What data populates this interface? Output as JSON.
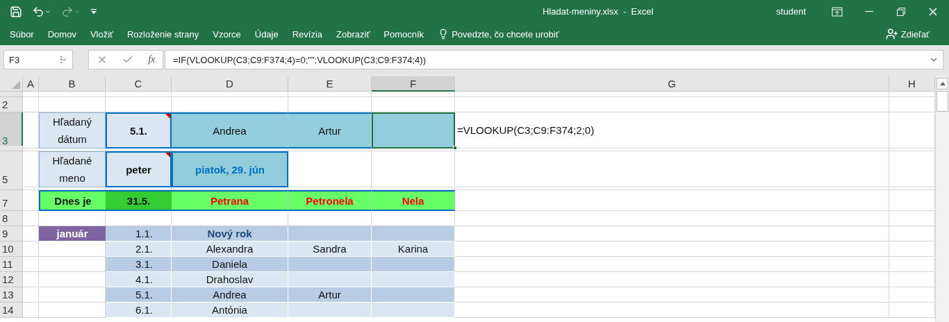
{
  "title_bar": {
    "quick_access": [
      {
        "kind": "save",
        "disabled": false
      },
      {
        "kind": "undo",
        "disabled": false
      },
      {
        "kind": "redo",
        "disabled": true
      },
      {
        "kind": "customize",
        "disabled": false
      }
    ],
    "title": "Hladat-meniny.xlsx  -  Excel",
    "user": "student"
  },
  "ribbon": {
    "tabs": [
      {
        "label": "Súbor",
        "selected": false
      },
      {
        "label": "Domov",
        "selected": false
      },
      {
        "label": "Vložiť",
        "selected": false
      },
      {
        "label": "Rozloženie strany",
        "selected": false
      },
      {
        "label": "Vzorce",
        "selected": false
      },
      {
        "label": "Údaje",
        "selected": false
      },
      {
        "label": "Revízia",
        "selected": false
      },
      {
        "label": "Zobraziť",
        "selected": false
      },
      {
        "label": "Pomocník",
        "selected": false
      }
    ],
    "tell_me": "Povedzte, čo chcete urobiť",
    "share": "Zdieľať"
  },
  "formula_bar": {
    "name_box": "F3",
    "function_label": "fx",
    "formula": "=IF(VLOOKUP(C3;C9:F374;4)=0;\"\";VLOOKUP(C3;C9:F374;4))"
  },
  "sheet": {
    "columns": [
      {
        "label": "A",
        "selected": false
      },
      {
        "label": "B",
        "selected": false
      },
      {
        "label": "C",
        "selected": false
      },
      {
        "label": "D",
        "selected": false
      },
      {
        "label": "E",
        "selected": false
      },
      {
        "label": "F",
        "selected": true
      },
      {
        "label": "G",
        "selected": false
      },
      {
        "label": "H",
        "selected": false
      }
    ],
    "rows": [
      {
        "kind": "hidden"
      },
      {
        "kind": "normal",
        "number": "2",
        "selected": false,
        "cells": [
          {
            "kind": "blank"
          },
          {
            "kind": "blank"
          },
          {
            "kind": "blank"
          },
          {
            "kind": "blank"
          },
          {
            "kind": "blank"
          },
          {
            "kind": "blank"
          },
          {
            "kind": "blank"
          },
          {
            "kind": "blank"
          }
        ]
      },
      {
        "kind": "tall",
        "number": "3",
        "selected": true,
        "cells": [
          {
            "kind": "blank"
          },
          {
            "kind": "label",
            "text": "Hľadaný dátum"
          },
          {
            "kind": "input",
            "text": "5.1.",
            "comment": true
          },
          {
            "kind": "result",
            "text": "Andrea"
          },
          {
            "kind": "result",
            "text": "Artur"
          },
          {
            "kind": "result",
            "selected": true
          },
          {
            "kind": "formula",
            "text": "=VLOOKUP(C3;C9:F374;2;0)"
          },
          {
            "kind": "blank"
          }
        ]
      },
      {
        "kind": "hidden"
      },
      {
        "kind": "tall",
        "number": "5",
        "selected": false,
        "cells": [
          {
            "kind": "blank"
          },
          {
            "kind": "label",
            "text": "Hľadané meno"
          },
          {
            "kind": "input",
            "text": "peter",
            "comment": true
          },
          {
            "kind": "result-date",
            "text": "piatok, 29. jún"
          },
          {
            "kind": "blank"
          },
          {
            "kind": "blank"
          },
          {
            "kind": "blank"
          },
          {
            "kind": "blank"
          }
        ]
      },
      {
        "kind": "hidden"
      },
      {
        "kind": "medium",
        "number": "7",
        "selected": false,
        "cells": [
          {
            "kind": "blank"
          },
          {
            "kind": "today-label",
            "text": "Dnes je"
          },
          {
            "kind": "today-date",
            "text": "31.5."
          },
          {
            "kind": "today-name",
            "text": "Petrana"
          },
          {
            "kind": "today-name",
            "text": "Petronela"
          },
          {
            "kind": "today-name",
            "text": "Nela"
          },
          {
            "kind": "blank"
          },
          {
            "kind": "blank"
          }
        ]
      },
      {
        "kind": "normal",
        "number": "8",
        "selected": false,
        "cells": [
          {
            "kind": "blank"
          },
          {
            "kind": "blank"
          },
          {
            "kind": "blank"
          },
          {
            "kind": "blank"
          },
          {
            "kind": "blank"
          },
          {
            "kind": "blank"
          },
          {
            "kind": "blank"
          },
          {
            "kind": "blank"
          }
        ]
      },
      {
        "kind": "normal",
        "number": "9",
        "selected": false,
        "cells": [
          {
            "kind": "blank"
          },
          {
            "kind": "month",
            "text": "január"
          },
          {
            "kind": "date-dark",
            "text": "1.1."
          },
          {
            "kind": "holiday-dark",
            "text": "Nový rok"
          },
          {
            "kind": "name-dark"
          },
          {
            "kind": "name-dark"
          },
          {
            "kind": "blank"
          },
          {
            "kind": "blank"
          }
        ]
      },
      {
        "kind": "normal",
        "number": "10",
        "selected": false,
        "cells": [
          {
            "kind": "blank"
          },
          {
            "kind": "blank"
          },
          {
            "kind": "date-light",
            "text": "2.1."
          },
          {
            "kind": "name-light",
            "text": "Alexandra"
          },
          {
            "kind": "name-light",
            "text": "Sandra"
          },
          {
            "kind": "name-light",
            "text": "Karina"
          },
          {
            "kind": "blank"
          },
          {
            "kind": "blank"
          }
        ]
      },
      {
        "kind": "normal",
        "number": "11",
        "selected": false,
        "cells": [
          {
            "kind": "blank"
          },
          {
            "kind": "blank"
          },
          {
            "kind": "date-dark",
            "text": "3.1."
          },
          {
            "kind": "name-dark",
            "text": "Daniela"
          },
          {
            "kind": "name-dark"
          },
          {
            "kind": "name-dark"
          },
          {
            "kind": "blank"
          },
          {
            "kind": "blank"
          }
        ]
      },
      {
        "kind": "normal",
        "number": "12",
        "selected": false,
        "cells": [
          {
            "kind": "blank"
          },
          {
            "kind": "blank"
          },
          {
            "kind": "date-light",
            "text": "4.1."
          },
          {
            "kind": "name-light",
            "text": "Drahoslav"
          },
          {
            "kind": "name-light"
          },
          {
            "kind": "name-light"
          },
          {
            "kind": "blank"
          },
          {
            "kind": "blank"
          }
        ]
      },
      {
        "kind": "normal",
        "number": "13",
        "selected": false,
        "cells": [
          {
            "kind": "blank"
          },
          {
            "kind": "blank"
          },
          {
            "kind": "date-dark",
            "text": "5.1."
          },
          {
            "kind": "name-dark",
            "text": "Andrea"
          },
          {
            "kind": "name-dark",
            "text": "Artur"
          },
          {
            "kind": "name-dark"
          },
          {
            "kind": "blank"
          },
          {
            "kind": "blank"
          }
        ]
      },
      {
        "kind": "normal",
        "number": "14",
        "selected": false,
        "cells": [
          {
            "kind": "blank"
          },
          {
            "kind": "blank"
          },
          {
            "kind": "date-light",
            "text": "6.1."
          },
          {
            "kind": "name-light",
            "text": "Antónia"
          },
          {
            "kind": "name-light"
          },
          {
            "kind": "name-light"
          },
          {
            "kind": "blank"
          },
          {
            "kind": "blank"
          }
        ]
      }
    ]
  }
}
